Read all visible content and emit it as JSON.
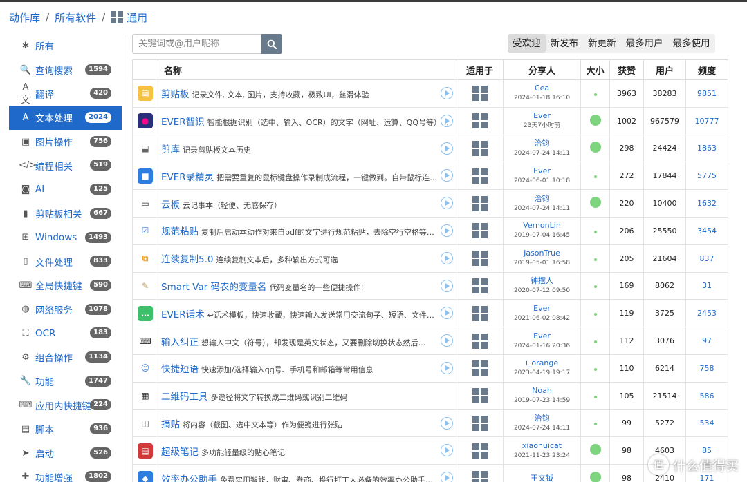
{
  "breadcrumb": {
    "root": "动作库",
    "sep1": "/",
    "all": "所有软件",
    "sep2": "/",
    "current": "通用"
  },
  "search": {
    "placeholder": "关键词或@用户昵称"
  },
  "sort_tabs": [
    {
      "label": "受欢迎",
      "active": true
    },
    {
      "label": "新发布"
    },
    {
      "label": "新更新"
    },
    {
      "label": "最多用户"
    },
    {
      "label": "最多使用"
    }
  ],
  "sidebar": [
    {
      "label": "所有",
      "icon": "asterisk-icon",
      "glyph": "✱",
      "badge": ""
    },
    {
      "label": "查询搜索",
      "icon": "search-icon",
      "glyph": "🔍",
      "badge": "1594"
    },
    {
      "label": "翻译",
      "icon": "translate-icon",
      "glyph": "A文",
      "badge": "420"
    },
    {
      "label": "文本处理",
      "icon": "text-icon",
      "glyph": "A",
      "badge": "2024",
      "active": true
    },
    {
      "label": "图片操作",
      "icon": "image-icon",
      "glyph": "▣",
      "badge": "756"
    },
    {
      "label": "编程相关",
      "icon": "code-icon",
      "glyph": "</>",
      "badge": "519"
    },
    {
      "label": "AI",
      "icon": "robot-icon",
      "glyph": "◙",
      "badge": "125"
    },
    {
      "label": "剪贴板相关",
      "icon": "clipboard-icon",
      "glyph": "▮",
      "badge": "667"
    },
    {
      "label": "Windows",
      "icon": "windows-icon",
      "glyph": "⊞",
      "badge": "1493"
    },
    {
      "label": "文件处理",
      "icon": "file-icon",
      "glyph": "▯",
      "badge": "833"
    },
    {
      "label": "全局快捷键",
      "icon": "keyboard-icon",
      "glyph": "⌨",
      "badge": "590"
    },
    {
      "label": "网络服务",
      "icon": "globe-icon",
      "glyph": "◍",
      "badge": "1078"
    },
    {
      "label": "OCR",
      "icon": "ocr-icon",
      "glyph": "⛶",
      "badge": "183"
    },
    {
      "label": "组合操作",
      "icon": "cogs-icon",
      "glyph": "⚙",
      "badge": "1134"
    },
    {
      "label": "功能",
      "icon": "wrench-icon",
      "glyph": "🔧",
      "badge": "1747"
    },
    {
      "label": "应用内快捷键",
      "icon": "app-keyboard-icon",
      "glyph": "⌨",
      "badge": "224"
    },
    {
      "label": "脚本",
      "icon": "script-icon",
      "glyph": "▤",
      "badge": "936"
    },
    {
      "label": "启动",
      "icon": "paper-plane-icon",
      "glyph": "➤",
      "badge": "526"
    },
    {
      "label": "功能增强",
      "icon": "puzzle-icon",
      "glyph": "✚",
      "badge": "1802"
    }
  ],
  "table": {
    "headers": {
      "name": "名称",
      "platform": "适用于",
      "sharer": "分享人",
      "size": "大小",
      "likes": "获赞",
      "users": "用户",
      "freq": "频度"
    },
    "rows": [
      {
        "title": "剪贴板",
        "desc": "记录文件, 文本, 图片，支持收藏，极致UI，丝滑体验",
        "user": "Cea",
        "date": "2024-01-18 16:10",
        "size": "small",
        "likes": "3963",
        "users": "38283",
        "freq": "9851",
        "icon_bg": "#f5c242",
        "icon_ch": "▤",
        "icon_fg": "#fff",
        "play": true
      },
      {
        "title": "EVER智识",
        "desc": "智能根据识别（选中、输入、OCR）的文字（网址、运算、QQ号等）…",
        "user": "Ever",
        "date": "23天7小时前",
        "size": "large",
        "likes": "1002",
        "users": "967579",
        "freq": "10777",
        "icon_bg": "#2a2f7a",
        "icon_ch": "●",
        "icon_fg": "#f08",
        "play": true
      },
      {
        "title": "剪库",
        "desc": "记录剪贴板文本历史",
        "user": "治钧",
        "date": "2024-07-24 14:11",
        "size": "large",
        "likes": "298",
        "users": "24424",
        "freq": "1863",
        "icon_bg": "#fff",
        "icon_ch": "⬓",
        "icon_fg": "#666",
        "play": true
      },
      {
        "title": "EVER录精灵",
        "desc": "把需要重复的鼠标键盘操作录制成流程，一键做到。自带鼠标连…",
        "user": "Ever",
        "date": "2024-06-01 10:18",
        "size": "small",
        "likes": "272",
        "users": "17844",
        "freq": "5775",
        "icon_bg": "#2e7de0",
        "icon_ch": "■",
        "icon_fg": "#fff",
        "play": true
      },
      {
        "title": "云板",
        "desc": "云记事本（轻便、无感保存）",
        "user": "治钧",
        "date": "2024-07-24 14:11",
        "size": "large",
        "likes": "220",
        "users": "10400",
        "freq": "1632",
        "icon_bg": "#fff",
        "icon_ch": "▭",
        "icon_fg": "#333",
        "play": true
      },
      {
        "title": "规范粘贴",
        "desc": "复制后启动本动作对来自pdf的文字进行规范粘贴，去除空行空格等…",
        "user": "VernonLin",
        "date": "2019-07-04 16:45",
        "size": "small",
        "likes": "206",
        "users": "25550",
        "freq": "3454",
        "icon_bg": "#fff",
        "icon_ch": "☑",
        "icon_fg": "#2e7de0",
        "play": true
      },
      {
        "title": "连续复制5.0",
        "desc": "连续复制文本后，多种输出方式可选",
        "user": "JasonTrue",
        "date": "2019-05-01 16:58",
        "size": "small",
        "likes": "205",
        "users": "21604",
        "freq": "837",
        "icon_bg": "#fff",
        "icon_ch": "⧉",
        "icon_fg": "#f0a020",
        "play": true
      },
      {
        "title": "Smart Var 码农的变量名",
        "desc": "代码变量名的一些便捷操作!",
        "user": "钟摆人",
        "date": "2020-07-12 09:50",
        "size": "small",
        "likes": "169",
        "users": "8062",
        "freq": "31",
        "icon_bg": "#fff",
        "icon_ch": "✎",
        "icon_fg": "#c0a060",
        "play": true
      },
      {
        "title": "EVER话术",
        "desc": "↩话术模板，快速收藏，快速输入发送常用交流句子、短语、文件…",
        "user": "Ever",
        "date": "2021-06-02 08:42",
        "size": "small",
        "likes": "119",
        "users": "3725",
        "freq": "2453",
        "icon_bg": "#3cc06a",
        "icon_ch": "…",
        "icon_fg": "#fff",
        "play": true
      },
      {
        "title": "输入纠正",
        "desc": "想输入中文（符号），却发现是英文状态，又要删除切换状态然后…",
        "user": "Ever",
        "date": "2024-01-16 20:36",
        "size": "small",
        "likes": "112",
        "users": "3076",
        "freq": "97",
        "icon_bg": "#fff",
        "icon_ch": "⌨",
        "icon_fg": "#222",
        "play": true
      },
      {
        "title": "快捷短语",
        "desc": "快速添加/选择输入qq号、手机号和邮箱等常用信息",
        "user": "i_orange",
        "date": "2023-04-19 19:17",
        "size": "small",
        "likes": "110",
        "users": "6214",
        "freq": "758",
        "icon_bg": "#fff",
        "icon_ch": "☺",
        "icon_fg": "#2e7de0",
        "play": true
      },
      {
        "title": "二维码工具",
        "desc": "多途径将文字转换成二维码或识别二维码",
        "user": "Noah",
        "date": "2019-07-23 14:59",
        "size": "small",
        "likes": "105",
        "users": "21514",
        "freq": "586",
        "icon_bg": "#fff",
        "icon_ch": "▦",
        "icon_fg": "#222",
        "play": false
      },
      {
        "title": "摘贴",
        "desc": "将内容（截图、选中文本等）作为便笺进行张贴",
        "user": "治钧",
        "date": "2024-07-24 14:11",
        "size": "small",
        "likes": "99",
        "users": "5272",
        "freq": "534",
        "icon_bg": "#fff",
        "icon_ch": "◫",
        "icon_fg": "#555",
        "play": true
      },
      {
        "title": "超级笔记",
        "desc": "多功能轻量级的贴心笔记",
        "user": "xiaohuicat",
        "date": "2021-11-23 23:24",
        "size": "large",
        "likes": "98",
        "users": "4603",
        "freq": "85",
        "icon_bg": "#d23a3a",
        "icon_ch": "▤",
        "icon_fg": "#fff",
        "play": true
      },
      {
        "title": "效率办公助手",
        "desc": "免费实用智能，财审、券商、投行打工人必备的效率办公助手…",
        "user": "王文钺",
        "date": "",
        "size": "large",
        "likes": "98",
        "users": "2410",
        "freq": "171",
        "icon_bg": "#2e7de0",
        "icon_ch": "◆",
        "icon_fg": "#fff",
        "play": true
      }
    ]
  },
  "watermark": {
    "text": "什么值得买",
    "icon": "smzdm-logo-icon",
    "glyph": "值"
  }
}
